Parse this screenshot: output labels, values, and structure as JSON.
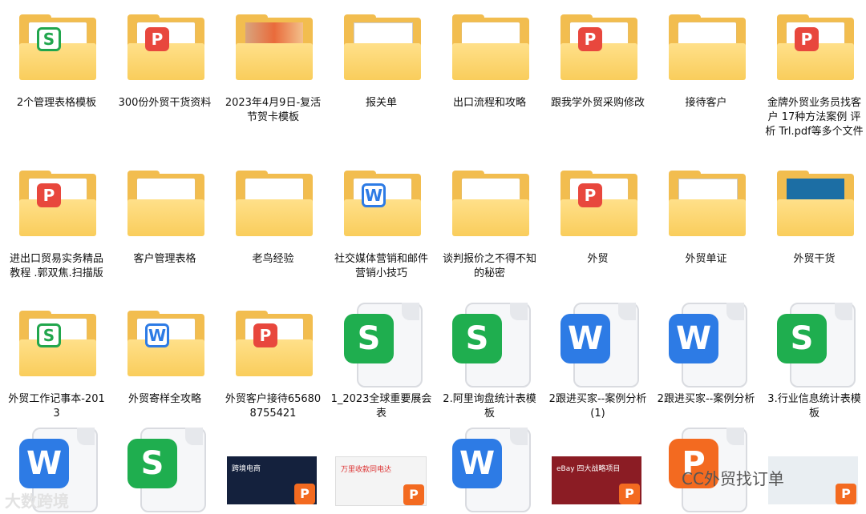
{
  "files": [
    {
      "name": "2个管理表格模板",
      "kind": "folder",
      "badge": "S"
    },
    {
      "name": "300份外贸干货资料",
      "kind": "folder",
      "badge": "P"
    },
    {
      "name": "2023年4月9日-复活节贺卡模板",
      "kind": "folder",
      "badge": "photo"
    },
    {
      "name": "报关单",
      "kind": "folder",
      "badge": "doc"
    },
    {
      "name": "出口流程和攻略",
      "kind": "folder",
      "badge": ""
    },
    {
      "name": "跟我学外贸采购修改",
      "kind": "folder",
      "badge": "P"
    },
    {
      "name": "接待客户",
      "kind": "folder",
      "badge": ""
    },
    {
      "name": "金牌外贸业务员找客户 17种方法案例 评析 Trl.pdf等多个文件",
      "kind": "folder",
      "badge": "P"
    },
    {
      "name": "进出口贸易实务精品教程 .郭双焦.扫描版",
      "kind": "folder",
      "badge": "P"
    },
    {
      "name": "客户管理表格",
      "kind": "folder",
      "badge": ""
    },
    {
      "name": "老鸟经验",
      "kind": "folder",
      "badge": ""
    },
    {
      "name": "社交媒体营销和邮件营销小技巧",
      "kind": "folder",
      "badge": "W"
    },
    {
      "name": "谈判报价之不得不知的秘密",
      "kind": "folder",
      "badge": ""
    },
    {
      "name": "外贸",
      "kind": "folder",
      "badge": "P"
    },
    {
      "name": "外贸单证",
      "kind": "folder",
      "badge": "doc"
    },
    {
      "name": "外贸干货",
      "kind": "folder",
      "badge": "screen"
    },
    {
      "name": "外贸工作记事本-2013",
      "kind": "folder",
      "badge": "S"
    },
    {
      "name": "外贸寄样全攻略",
      "kind": "folder",
      "badge": "W"
    },
    {
      "name": "外贸客户接待656808755421",
      "kind": "folder",
      "badge": "P"
    },
    {
      "name": "1_2023全球重要展会表",
      "kind": "file",
      "badge": "S"
    },
    {
      "name": "2.阿里询盘统计表模板",
      "kind": "file",
      "badge": "S"
    },
    {
      "name": "2跟进买家--案例分析(1)",
      "kind": "file",
      "badge": "W"
    },
    {
      "name": "2跟进买家--案例分析",
      "kind": "file",
      "badge": "W"
    },
    {
      "name": "3.行业信息统计表模板",
      "kind": "file",
      "badge": "S"
    },
    {
      "name": "",
      "kind": "file",
      "badge": "W"
    },
    {
      "name": "",
      "kind": "file",
      "badge": "S"
    },
    {
      "name": "",
      "kind": "thumb",
      "badge": "t1",
      "caption": "跨境电商"
    },
    {
      "name": "",
      "kind": "thumb",
      "badge": "t2",
      "caption": "万里收款同电达"
    },
    {
      "name": "",
      "kind": "file",
      "badge": "W"
    },
    {
      "name": "",
      "kind": "thumb",
      "badge": "t3",
      "caption": "eBay 四大战略项目"
    },
    {
      "name": "",
      "kind": "file",
      "badge": "P"
    },
    {
      "name": "",
      "kind": "thumb",
      "badge": "t4",
      "caption": ""
    }
  ],
  "watermark_left": "大数跨境",
  "watermark_right": "CC外贸找订单"
}
